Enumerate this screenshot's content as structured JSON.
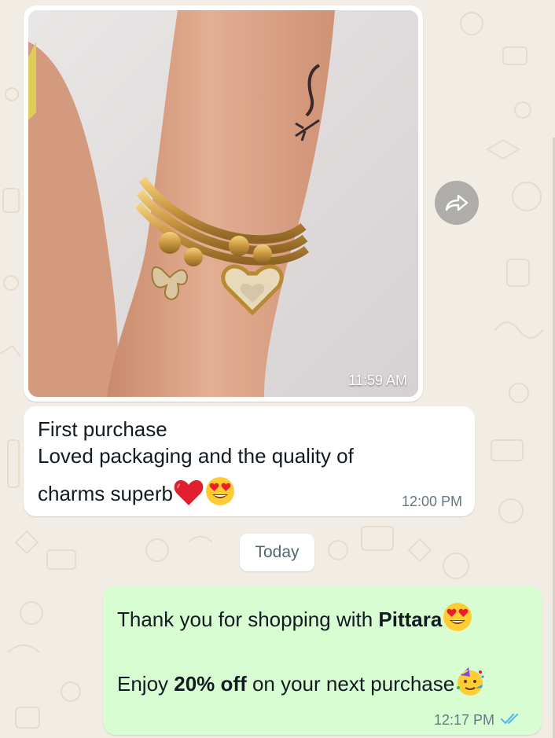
{
  "messages": {
    "incoming_image": {
      "time": "11:59 AM"
    },
    "incoming_text": {
      "line1": "First purchase",
      "line2": "Loved packaging and the quality of",
      "line3": "charms superb",
      "time": "12:00 PM"
    },
    "date_separator": "Today",
    "outgoing": {
      "line1_text": "Thank you for shopping with ",
      "line1_bold": "Pittara",
      "line2_text1": "Enjoy ",
      "line2_bold": "20% off",
      "line2_text2": " on your next purchase",
      "time": "12:17 PM",
      "status": "read"
    }
  },
  "icons": {
    "forward": "forward-icon",
    "read_receipt": "double-check-icon",
    "emoji_heart": "red-heart-emoji",
    "emoji_heart_eyes": "heart-eyes-emoji",
    "emoji_party": "partying-face-emoji"
  },
  "colors": {
    "wallpaper": "#f2ede4",
    "incoming_bubble": "#ffffff",
    "outgoing_bubble": "#d9fdd3",
    "time_text": "#667781",
    "read_receipt": "#53bdeb"
  }
}
